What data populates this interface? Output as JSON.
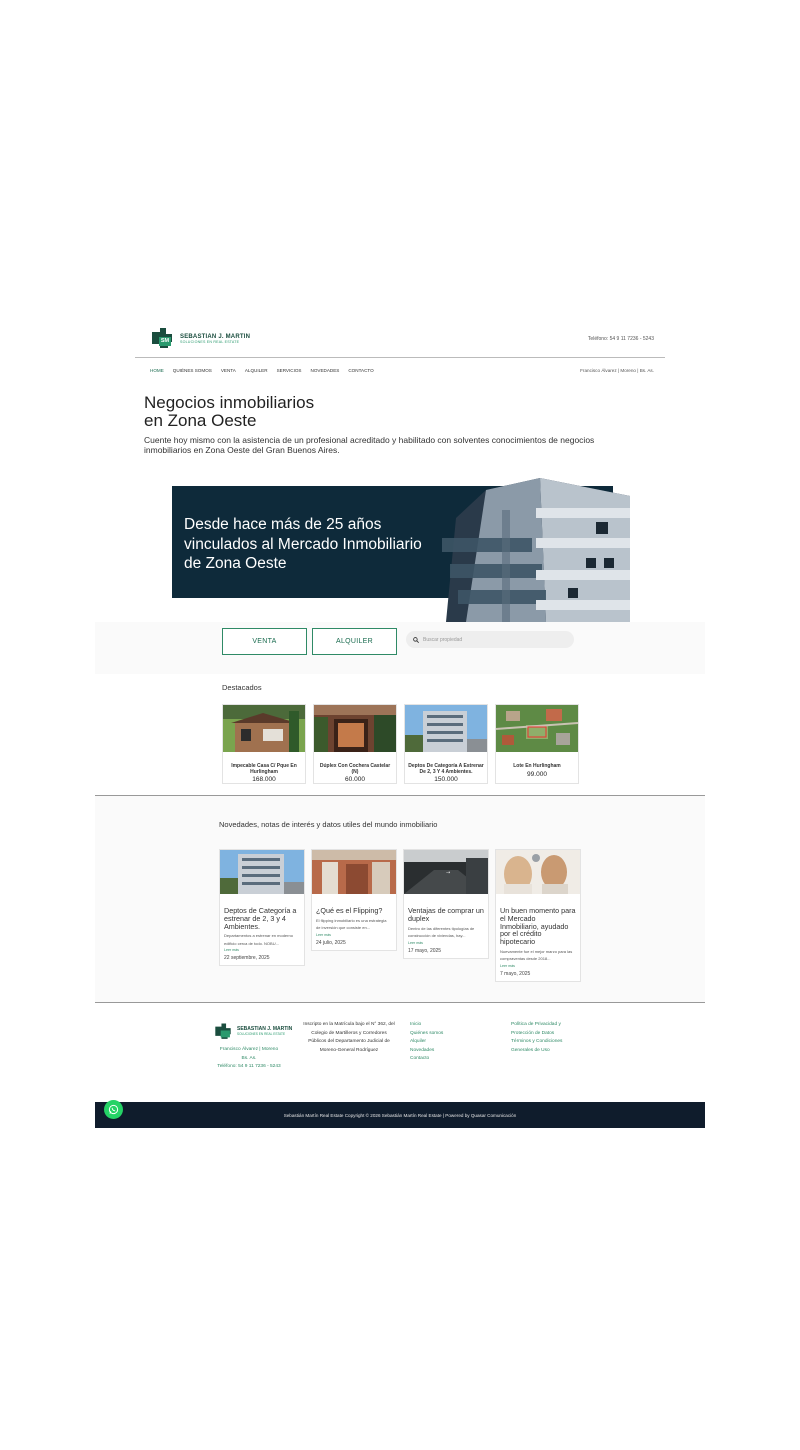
{
  "brand": {
    "name": "SEBASTIAN J. MARTIN",
    "tagline": "SOLUCIONES EN REAL ESTATE",
    "monogram": "SM",
    "primary_color": "#1a4d3e",
    "accent_color": "#2f8a66"
  },
  "header": {
    "phone": "Teléfono: 54 9 11 7236 - 5243",
    "location": "Francisco Álvarez | Moreno | Bs. As.",
    "nav": [
      "HOME",
      "QUIÉNES SOMOS",
      "VENTA",
      "ALQUILER",
      "SERVICIOS",
      "NOVEDADES",
      "CONTACTO"
    ]
  },
  "hero": {
    "title_line1": "Negocios inmobiliarios",
    "title_line2": "en Zona Oeste",
    "lead": "Cuente hoy mismo con la asistencia de un profesional acreditado y habilitado con solventes conocimientos de negocios inmobiliarios en Zona Oeste del Gran Buenos Aires."
  },
  "banner": {
    "line1": "Desde hace más de 25 años",
    "line2": "vinculados al Mercado Inmobiliario",
    "line3": "de Zona Oeste",
    "bg_color": "#0e2a3a"
  },
  "search": {
    "venta_label": "VENTA",
    "alquiler_label": "ALQUILER",
    "placeholder": "Buscar propiedad",
    "icon": "search-icon"
  },
  "featured": {
    "title": "Destacados",
    "items": [
      {
        "name": "Impecable Casa C/ Pque En Hurlingham",
        "price": "168.000"
      },
      {
        "name": "Dúplex Con Cochera Castelar (N)",
        "price": "60.000"
      },
      {
        "name": "Deptos De Categoría A Estrenar De 2, 3 Y 4 Ambientes.",
        "price": "150.000"
      },
      {
        "name": "Lote En Hurlingham",
        "price": "99.000"
      }
    ]
  },
  "news": {
    "title": "Novedades, notas de interés y datos utiles del mundo inmobiliario",
    "items": [
      {
        "title": "Deptos de Categoría a estrenar de 2, 3 y 4 Ambientes.",
        "excerpt": "Departamentos a estrenar en moderno edificio cerca de todo. NOBU...",
        "more": "Leer más",
        "date": "22 septiembre, 2025"
      },
      {
        "title": "¿Qué es el Flipping?",
        "excerpt": "El flipping inmobiliario es una estrategia de inversión que consiste en...",
        "more": "Leer más",
        "date": "24 julio, 2025"
      },
      {
        "title": "Ventajas de comprar un duplex",
        "excerpt": "Dentro de las diferentes tipologías de construcción de viviendas, hay...",
        "more": "Leer más",
        "date": "17 mayo, 2025"
      },
      {
        "title": "Un buen momento para el Mercado Inmobiliario, ayudado por el crédito hipotecario",
        "excerpt": "Nuevamente fue el mejor marzo para las compraventas desde 2018...",
        "more": "Leer más",
        "date": "7 mayo, 2025"
      }
    ]
  },
  "footer": {
    "address_line1": "Francisco Álvarez | Moreno",
    "address_line2": "Bs. As.",
    "phone": "Teléfono: 54 9 11 7236 - 5243",
    "registration": "Inscripto en la Matrícula bajo el N° 362, del Colegio de Martilleros y Corredores Públicos del Departamento Judicial de Moreno-General Rodríguez",
    "links": [
      "Inicio",
      "Quiénes somos",
      "Alquiler",
      "Novedades",
      "Contacto"
    ],
    "legal": [
      "Política de Privacidad y Protección de Datos",
      "Términos y Condiciones Generales de Uso"
    ],
    "copyright": "Sebastián Martín Real Estate Copyright © 2026 Sebastián Martín Real Estate | Powered by Quasar Comunicación"
  }
}
